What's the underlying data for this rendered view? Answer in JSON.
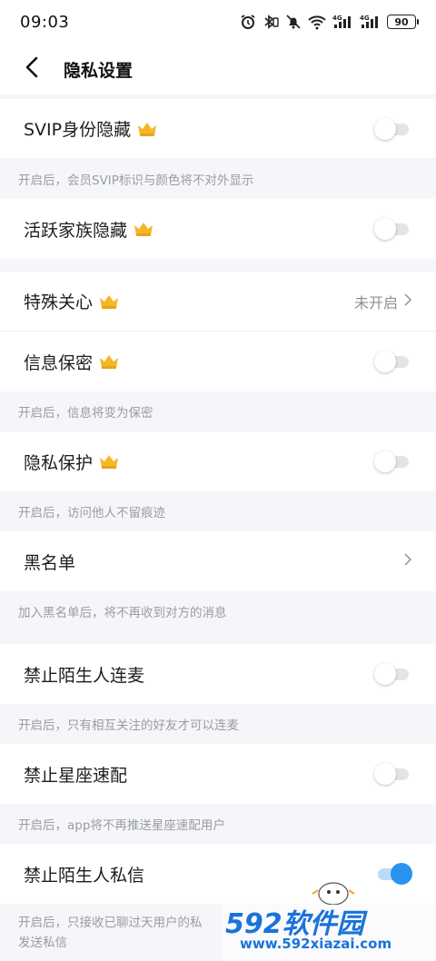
{
  "status_bar": {
    "time": "09:03",
    "battery": "90",
    "icons": [
      "alarm-icon",
      "bluetooth-icon",
      "mute-icon",
      "wifi-icon",
      "signal-4g-icon",
      "signal-4g-icon",
      "battery-icon"
    ]
  },
  "header": {
    "title": "隐私设置",
    "back_icon": "chevron-left-icon"
  },
  "settings": {
    "svip_hide": {
      "label": "SVIP身份隐藏",
      "vip": true,
      "enabled": false,
      "hint": "开启后，会员SVIP标识与颜色将不对外显示"
    },
    "family_hide": {
      "label": "活跃家族隐藏",
      "vip": true,
      "enabled": false
    },
    "special_care": {
      "label": "特殊关心",
      "vip": true,
      "value": "未开启"
    },
    "info_secret": {
      "label": "信息保密",
      "vip": true,
      "enabled": false,
      "hint": "开启后，信息将变为保密"
    },
    "privacy_protect": {
      "label": "隐私保护",
      "vip": true,
      "enabled": false,
      "hint": "开启后，访问他人不留痕迹"
    },
    "blacklist": {
      "label": "黑名单",
      "hint": "加入黑名单后，将不再收到对方的消息"
    },
    "no_stranger_mic": {
      "label": "禁止陌生人连麦",
      "enabled": false,
      "hint": "开启后，只有相互关注的好友才可以连麦"
    },
    "no_star_match": {
      "label": "禁止星座速配",
      "enabled": false,
      "hint": "开启后，app将不再推送星座速配用户"
    },
    "no_stranger_dm": {
      "label": "禁止陌生人私信",
      "enabled": true,
      "hint_line1": "开启后，只接收已聊过天用户的私",
      "hint_line2": "发送私信"
    }
  },
  "watermark": {
    "brand": "592软件园",
    "url": "www.592xiazai.com"
  },
  "colors": {
    "accent": "#2a93ee",
    "crown": "#f5b72a",
    "watermark": "#1a73d9"
  }
}
